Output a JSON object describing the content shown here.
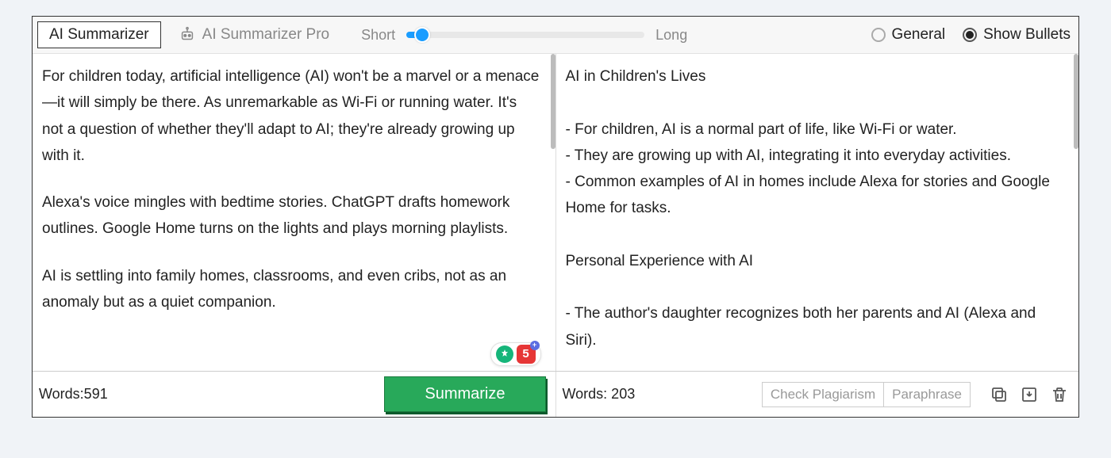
{
  "toolbar": {
    "tab_active": "AI Summarizer",
    "tab_pro": "AI Summarizer Pro",
    "slider_min_label": "Short",
    "slider_max_label": "Long"
  },
  "mode": {
    "general": "General",
    "bullets": "Show Bullets"
  },
  "input": {
    "paragraphs": [
      "For children today, artificial intelligence (AI) won't be a marvel or a menace—it will simply be there. As unremarkable as Wi-Fi or running water. It's not a question of whether they'll adapt to AI; they're already growing up with it.",
      "Alexa's voice mingles with bedtime stories. ChatGPT drafts homework outlines. Google Home turns on the lights and plays morning playlists.",
      "AI is settling into family homes, classrooms, and even cribs, not as an anomaly but as a quiet companion."
    ]
  },
  "output": {
    "lines": [
      "AI in Children's Lives",
      "",
      "- For children, AI is a normal part of life, like Wi-Fi or water.",
      "- They are growing up with AI, integrating it into everyday activities.",
      "- Common examples of AI in homes include Alexa for stories and Google Home for tasks.",
      "",
      "Personal Experience with AI",
      "",
      "- The author's daughter recognizes both her parents and AI (Alexa and Siri)."
    ]
  },
  "footer": {
    "words_input_label": "Words:591",
    "words_output_label": "Words: 203",
    "summarize_label": "Summarize",
    "check_plagiarism_label": "Check Plagiarism",
    "paraphrase_label": "Paraphrase"
  },
  "badges": {
    "red_value": "5"
  }
}
